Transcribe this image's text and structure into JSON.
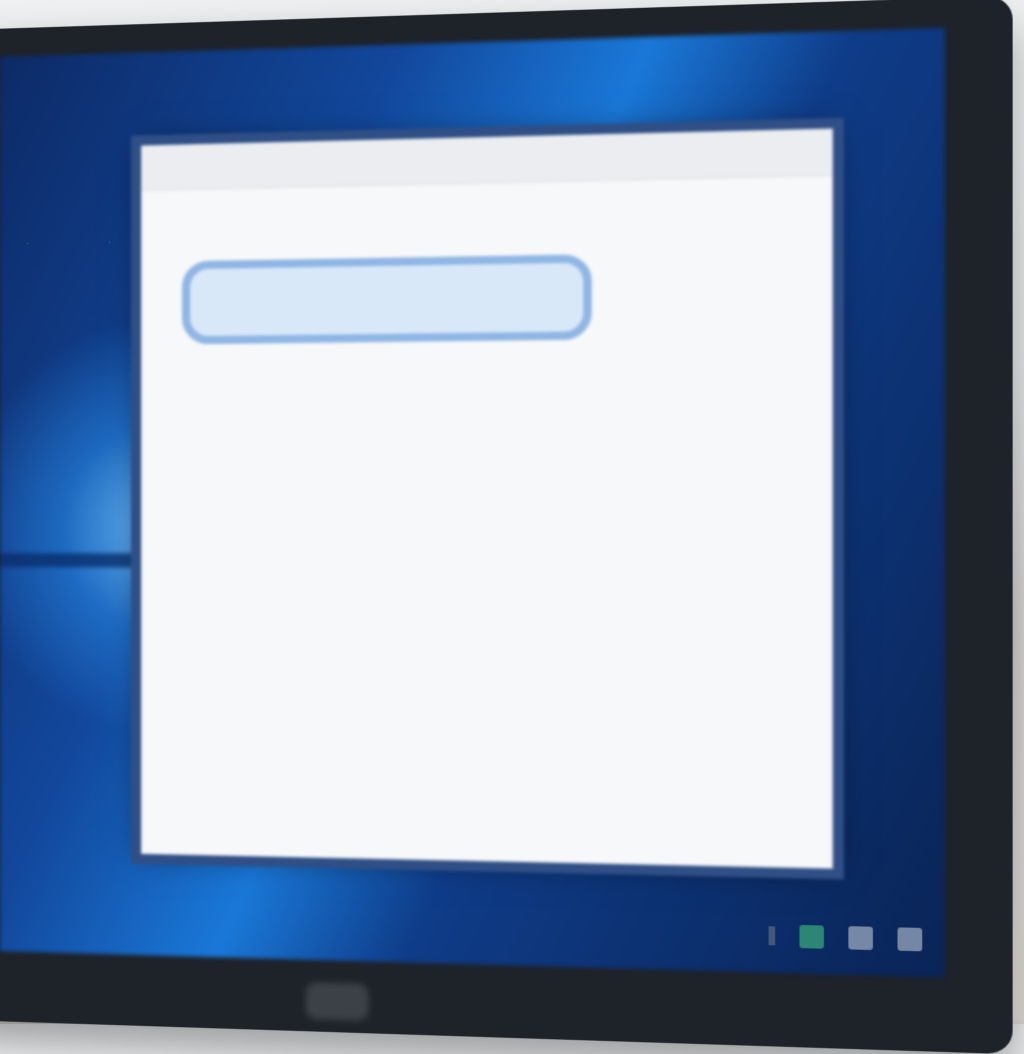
{
  "window": {
    "title": "",
    "heading": "",
    "subheading": "",
    "items": [
      {
        "label": "",
        "sub": ""
      },
      {
        "label": "",
        "sub": ""
      },
      {
        "label": "",
        "sub": ""
      }
    ],
    "selected_item": {
      "label": ""
    },
    "last_item": {
      "label": ""
    }
  },
  "taskbar": {
    "tray_icons": [
      "pin-icon",
      "app-icon-green",
      "app-icon",
      "notification-icon"
    ]
  },
  "colors": {
    "desktop_blue": "#1a78d8",
    "selection_fill": "#d8e8f8",
    "selection_border": "#8fb6e4"
  }
}
